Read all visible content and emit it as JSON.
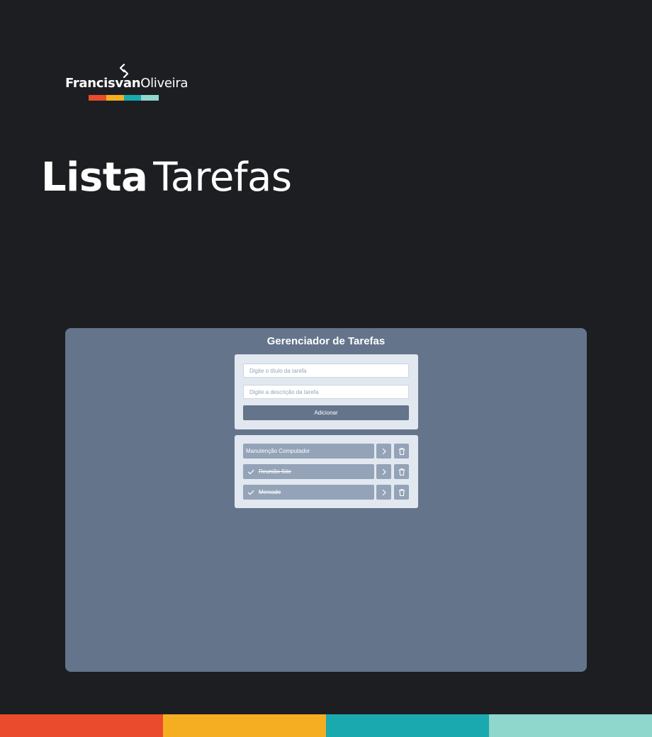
{
  "brand": {
    "first_name": "Francisvan",
    "last_name": "Oliveira",
    "colors": [
      "#e94b2c",
      "#f5ae22",
      "#1ba9b0",
      "#8fd6cc"
    ]
  },
  "hero": {
    "title_bold": "Lista",
    "title_light": "Tarefas"
  },
  "app": {
    "title": "Gerenciador de Tarefas",
    "form": {
      "title_placeholder": "Digite o título da tarefa",
      "description_placeholder": "Digite a descrição da tarefa",
      "add_label": "Adicionar"
    },
    "tasks": [
      {
        "title": "Manutenção Computador",
        "completed": false
      },
      {
        "title": "Reunião Site",
        "completed": true
      },
      {
        "title": "Mercado",
        "completed": true
      }
    ],
    "icons": {
      "details": "chevron-right-icon",
      "delete": "trash-icon",
      "completed": "check-icon"
    }
  },
  "colors": {
    "page_background": "#1c1e21",
    "panel_background": "#64748b",
    "card_background": "#e2e8f0",
    "task_background": "#94a3b8"
  }
}
